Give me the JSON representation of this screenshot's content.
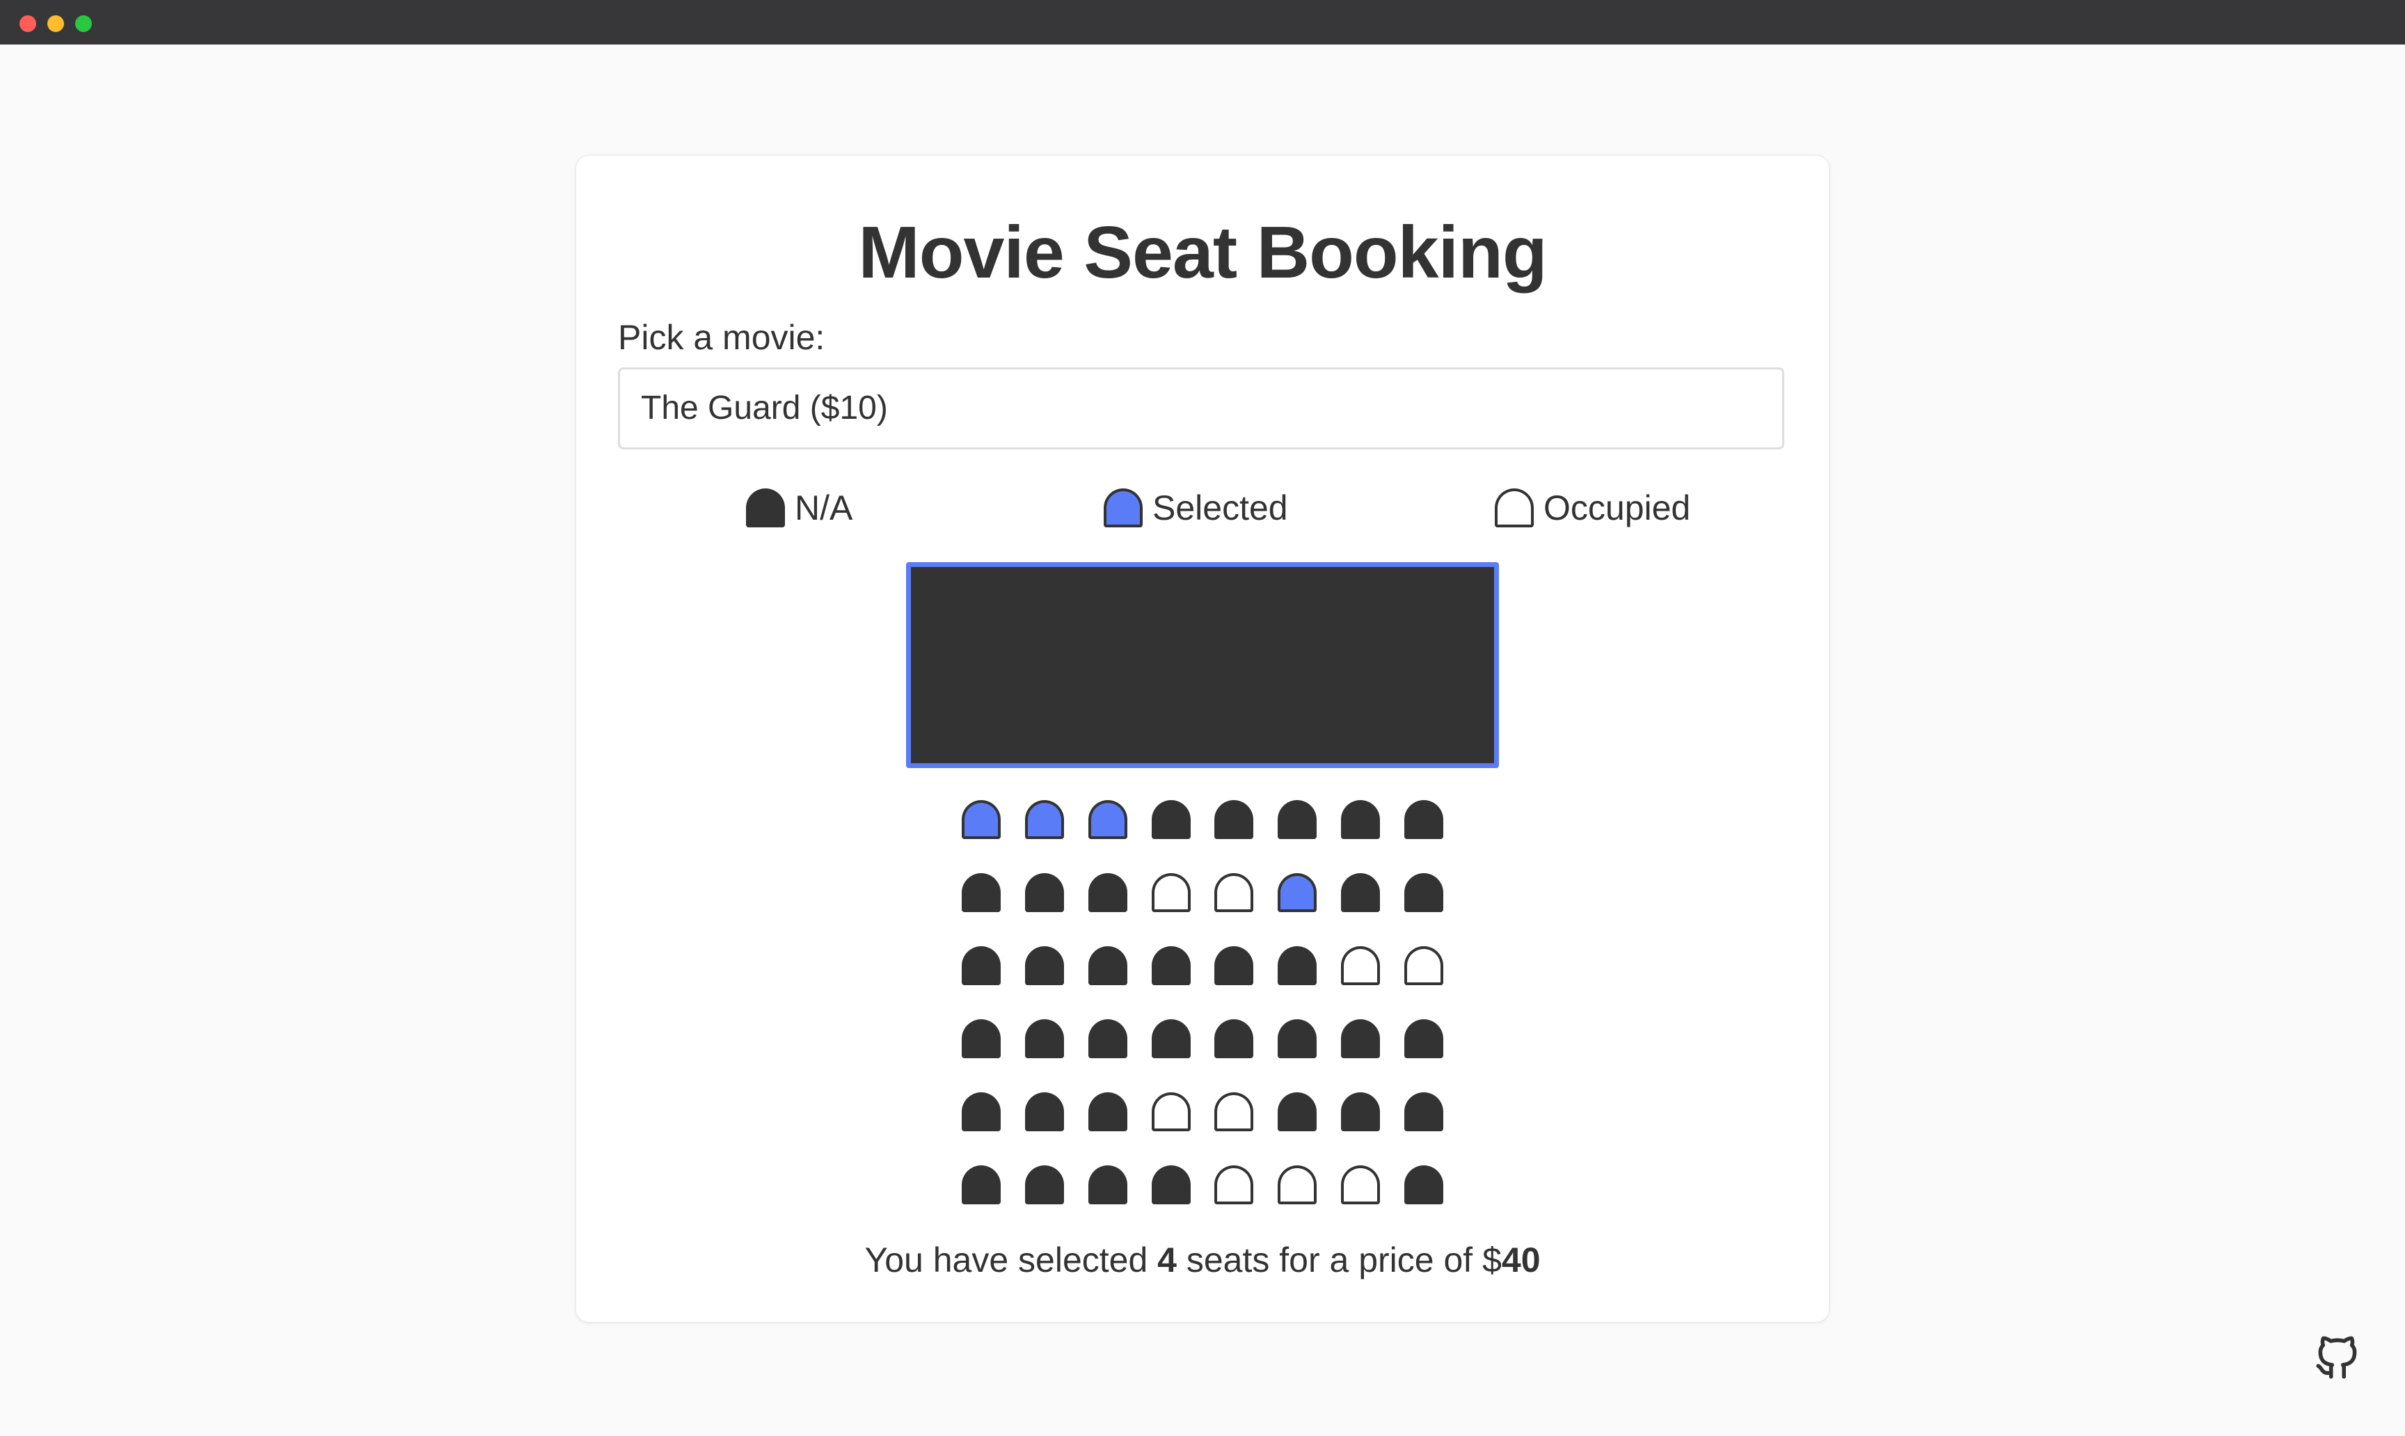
{
  "colors": {
    "accent": "#5b7cf7",
    "seat_dark": "#333333",
    "background": "#fafafa",
    "card": "#ffffff"
  },
  "app": {
    "title": "Movie Seat Booking"
  },
  "movie_picker": {
    "label": "Pick a movie:",
    "selected_value": "The Guard ($10)"
  },
  "legend": [
    {
      "label": "N/A",
      "state": "na"
    },
    {
      "label": "Selected",
      "state": "selected"
    },
    {
      "label": "Occupied",
      "state": "occupied"
    }
  ],
  "seats": [
    [
      "selected",
      "selected",
      "selected",
      "na",
      "na",
      "na",
      "na",
      "na"
    ],
    [
      "na",
      "na",
      "na",
      "occupied",
      "occupied",
      "selected",
      "na",
      "na"
    ],
    [
      "na",
      "na",
      "na",
      "na",
      "na",
      "na",
      "occupied",
      "occupied"
    ],
    [
      "na",
      "na",
      "na",
      "na",
      "na",
      "na",
      "na",
      "na"
    ],
    [
      "na",
      "na",
      "na",
      "occupied",
      "occupied",
      "na",
      "na",
      "na"
    ],
    [
      "na",
      "na",
      "na",
      "na",
      "occupied",
      "occupied",
      "occupied",
      "na"
    ]
  ],
  "summary": {
    "prefix": "You have selected ",
    "count": "4",
    "middle": " seats for a price of $",
    "price": "40"
  },
  "footer": {
    "icon": "github-icon"
  }
}
